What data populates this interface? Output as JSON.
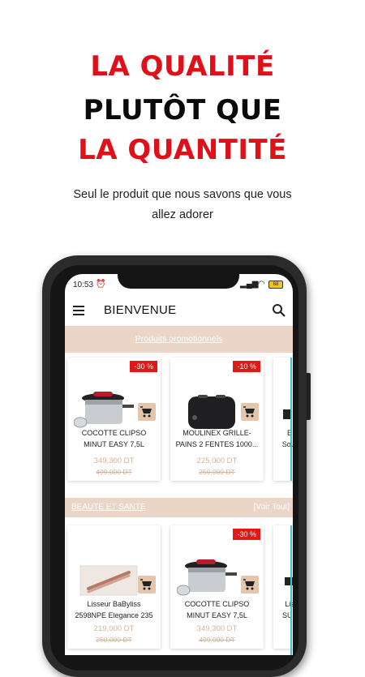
{
  "hero": {
    "line1_a": "LA",
    "line1_b": "QUALITÉ",
    "line2": "PLUTÔT QUE",
    "line3": "LA QUANTITÉ",
    "subtitle_1": "Seul le produit que nous savons que vous",
    "subtitle_2": "allez adorer"
  },
  "status_bar": {
    "time": "10:53",
    "battery": "68"
  },
  "app_bar": {
    "title": "BIENVENUE"
  },
  "promo": {
    "banner_label": "Produits promotionnels",
    "products": [
      {
        "name_1": "COCOTTE CLIPSO",
        "name_2": "MINUT EASY 7,5L",
        "price": "349,300 DT",
        "old_price": "499,000 DT",
        "discount": "-30 %"
      },
      {
        "name_1": "MOULINEX GRILLE-",
        "name_2": "PAINS 2 FENTES 1000...",
        "price": "225,000 DT",
        "old_price": "250,000 DT",
        "discount": "-10 %"
      },
      {
        "name_1": "E",
        "name_2": "Souf"
      }
    ]
  },
  "beauty": {
    "title": "BEAUTE ET SANTE",
    "link": "[Voir Tout]",
    "products": [
      {
        "name_1": "Lisseur BaByliss",
        "name_2": "2598NPE Elegance 235",
        "price": "219,000 DT",
        "old_price": "250,000 DT"
      },
      {
        "name_1": "COCOTTE CLIPSO",
        "name_2": "MINUT EASY 7,5L",
        "price": "349,300 DT",
        "old_price": "499,000 DT",
        "discount": "-30 %"
      },
      {
        "name_1": "Lis",
        "name_2": "SUF"
      }
    ]
  },
  "colors": {
    "brand_red": "#e0101a",
    "beige": "#ead5c6",
    "cart_button": "#e3c6ac",
    "discount_badge": "#e01818"
  }
}
